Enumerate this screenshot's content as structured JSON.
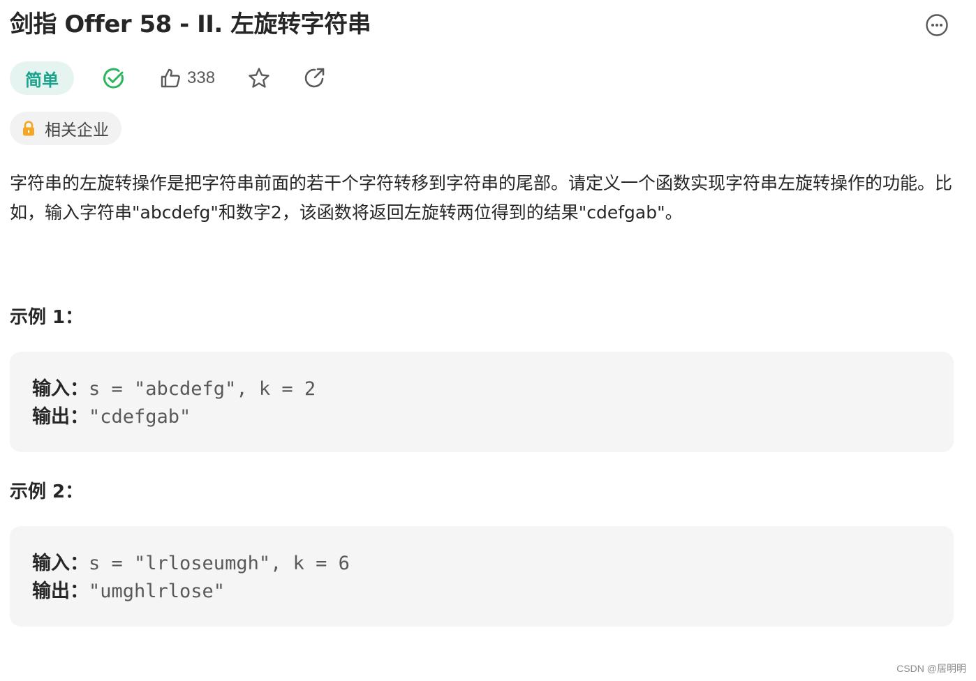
{
  "problem": {
    "title": "剑指 Offer 58 - II. 左旋转字符串",
    "difficulty": "简单",
    "likes": "338",
    "company_tag": "相关企业",
    "description": "字符串的左旋转操作是把字符串前面的若干个字符转移到字符串的尾部。请定义一个函数实现字符串左旋转操作的功能。比如，输入字符串\"abcdefg\"和数字2，该函数将返回左旋转两位得到的结果\"cdefgab\"。"
  },
  "examples": [
    {
      "title": "示例 1：",
      "input_label": "输入：",
      "input_value": "s = \"abcdefg\", k = 2",
      "output_label": "输出：",
      "output_value": "\"cdefgab\""
    },
    {
      "title": "示例 2：",
      "input_label": "输入：",
      "input_value": "s = \"lrloseumgh\", k = 6",
      "output_label": "输出：",
      "output_value": "\"umghlrlose\""
    }
  ],
  "watermark": "CSDN @居明明",
  "colors": {
    "difficulty_bg": "#e6f4f1",
    "difficulty_text": "#1aa38c",
    "solved_check": "#2db55d",
    "lock": "#f5a623",
    "code_bg": "#f5f5f5"
  },
  "icons": [
    "more-icon",
    "check-circle-icon",
    "thumbs-up-icon",
    "star-icon",
    "share-icon",
    "lock-icon"
  ]
}
